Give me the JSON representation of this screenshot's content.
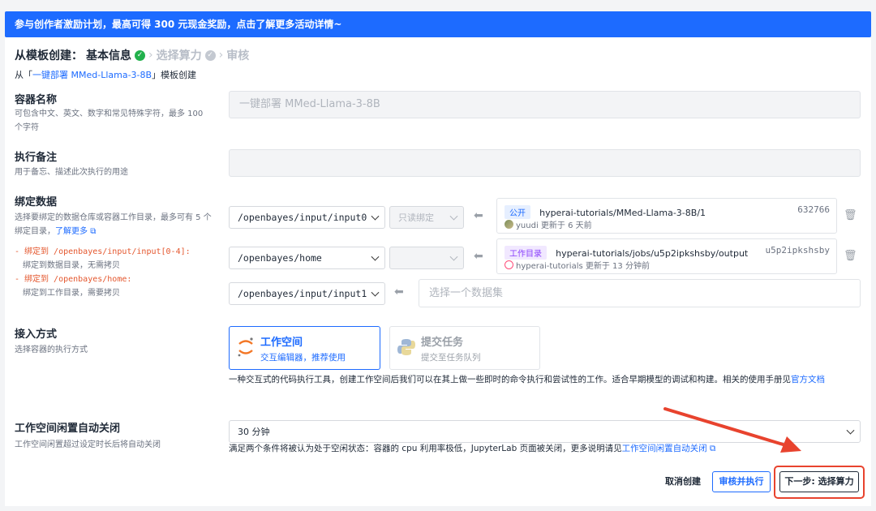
{
  "banner": {
    "text": "参与创作者激励计划，最高可得 300 元现金奖励，点击了解更多活动详情~"
  },
  "steps": {
    "title": "从模板创建：",
    "step1": "基本信息",
    "step2": "选择算力",
    "step3": "审核"
  },
  "from": {
    "prefix": "从「",
    "template": "一键部署 MMed-Llama-3-8B",
    "suffix": "」模板创建"
  },
  "container_name": {
    "label": "容器名称",
    "desc": "可包含中文、英文、数字和常见特殊字符，最多 100 个字符",
    "value": "一键部署 MMed-Llama-3-8B"
  },
  "exec_note": {
    "label": "执行备注",
    "desc": "用于备忘、描述此次执行的用途",
    "value": ""
  },
  "bind_data": {
    "label": "绑定数据",
    "desc_prefix": "选择要绑定的数据仓库或容器工作目录，最多可有 5 个绑定目录，",
    "learn_more": "了解更多",
    "rule1_a": "- 绑定到 /openbayes/input/input[0-4]:",
    "rule1_b": "绑定到数据目录，无需拷贝",
    "rule2_a": "- 绑定到 /openbayes/home:",
    "rule2_b": "绑定到工作目录，需要拷贝",
    "rows": [
      {
        "path": "/openbayes/input/input0",
        "mode": "只读绑定",
        "tag": "公开",
        "name": "hyperai-tutorials/MMed-Llama-3-8B/1",
        "id": "632766",
        "user": "yuudi",
        "updated": "更新于 6 天前"
      },
      {
        "path": "/openbayes/home",
        "mode": "",
        "tag": "工作目录",
        "name": "hyperai-tutorials/jobs/u5p2ipkshsby/output",
        "id": "u5p2ipkshsby",
        "user": "hyperai-tutorials",
        "updated": "更新于 13 分钟前"
      },
      {
        "path": "/openbayes/input/input1",
        "placeholder": "选择一个数据集"
      }
    ]
  },
  "access": {
    "label": "接入方式",
    "desc": "选择容器的执行方式",
    "workspace_title": "工作空间",
    "workspace_sub": "交互编辑器，推荐使用",
    "task_title": "提交任务",
    "task_sub": "提交至任务队列",
    "note": "一种交互式的代码执行工具，创建工作空间后我们可以在其上做一些即时的命令执行和尝试性的工作。适合早期模型的调试和构建。相关的使用手册见",
    "note_link": "官方文档"
  },
  "idle": {
    "label": "工作空间闲置自动关闭",
    "desc": "工作空间闲置超过设定时长后将自动关闭",
    "value": "30 分钟",
    "note": "满足两个条件将被认为处于空闲状态：容器的 cpu 利用率极低，JupyterLab 页面被关闭，更多说明请见",
    "note_link": "工作空间闲置自动关闭"
  },
  "footer": {
    "cancel": "取消创建",
    "review": "审核并执行",
    "next": "下一步: 选择算力"
  },
  "colors": {
    "accent": "#1d6bff",
    "success": "#22b14c",
    "highlight": "#e8432e"
  }
}
